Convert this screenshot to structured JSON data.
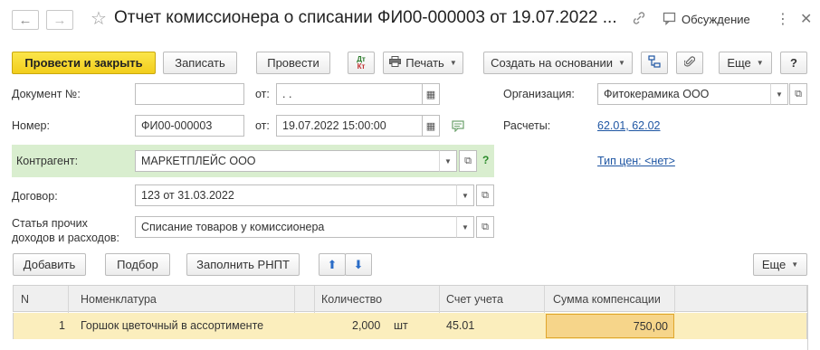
{
  "window": {
    "title": "Отчет комиссионера о списании ФИ00-000003 от 19.07.2022 ...",
    "discussion_label": "Обсуждение"
  },
  "toolbar": {
    "post_and_close": "Провести и закрыть",
    "save": "Записать",
    "post": "Провести",
    "dt_kt_icon": "Дт Кт",
    "print": "Печать",
    "create_based_on": "Создать на основании",
    "more": "Еще",
    "help": "?"
  },
  "form": {
    "doc_number_label": "Документ №:",
    "doc_number_value": "",
    "doc_date_label": "от:",
    "doc_date_value": " .  .",
    "number_label": "Номер:",
    "number_value": "ФИ00-000003",
    "date_label": "от:",
    "date_value": "19.07.2022 15:00:00",
    "org_label": "Организация:",
    "org_value": "Фитокерамика ООО",
    "settlements_label": "Расчеты:",
    "settlements_value": "62.01, 62.02",
    "counterparty_label": "Контрагент:",
    "counterparty_value": "МАРКЕТПЛЕЙС ООО",
    "counterparty_help": "?",
    "price_type_link": "Тип цен: <нет>",
    "contract_label": "Договор:",
    "contract_value": "123 от 31.03.2022",
    "article_label_line1": "Статья прочих",
    "article_label_line2": "доходов и расходов:",
    "article_value": "Списание товаров у комиссионера"
  },
  "table_toolbar": {
    "add": "Добавить",
    "pick": "Подбор",
    "fill": "Заполнить РНПТ",
    "more": "Еще"
  },
  "table": {
    "columns": [
      "N",
      "Номенклатура",
      "Количество",
      "Счет учета",
      "Сумма компенсации"
    ],
    "rows": [
      {
        "n": "1",
        "item": "Горшок цветочный в ассортименте",
        "qty": "2,000",
        "unit": "шт",
        "account": "45.01",
        "sum": "750,00"
      }
    ]
  },
  "icons": {
    "back": "arrow-left-icon",
    "forward": "arrow-right-icon",
    "favorite": "star-icon",
    "link": "link-icon",
    "discussion": "chat-icon",
    "menu": "kebab-menu-icon",
    "close": "close-icon"
  },
  "colors": {
    "primary_button": "#f2cd1c",
    "counterparty_band": "#d9eecf",
    "selected_row": "#fbeebd",
    "link": "#1f56a3"
  }
}
